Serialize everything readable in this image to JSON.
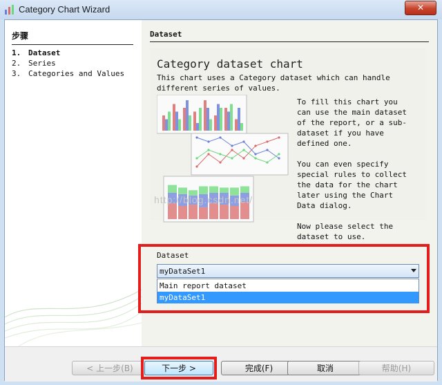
{
  "window": {
    "title": "Category Chart Wizard",
    "close_glyph": "✕"
  },
  "steps": {
    "heading": "步骤",
    "items": [
      {
        "num": "1.",
        "label": "Dataset",
        "active": true
      },
      {
        "num": "2.",
        "label": "Series",
        "active": false
      },
      {
        "num": "3.",
        "label": "Categories and Values",
        "active": false
      }
    ]
  },
  "main": {
    "section_title": "Dataset",
    "chart_title": "Category dataset chart",
    "description": "This chart uses a Category dataset which can handle different series of values.",
    "side_paragraphs": [
      "To fill this chart you can use the main dataset of the report, or a sub-dataset if you have defined one.",
      "You can even specify special rules to collect the data for the chart later using the Chart Data dialog.",
      "Now please select the dataset to use."
    ],
    "watermark": "http://blog.csdn.net/",
    "dataset": {
      "label": "Dataset",
      "selected": "myDataSet1",
      "options": [
        "Main report dataset",
        "myDataSet1"
      ],
      "highlighted_index": 1
    }
  },
  "preview": {
    "bar_values": [
      [
        4,
        7,
        6,
        5,
        8,
        4,
        6,
        3
      ],
      [
        3,
        5,
        8,
        2,
        6,
        7,
        5,
        6
      ],
      [
        5,
        3,
        4,
        6,
        3,
        6,
        7,
        2
      ]
    ],
    "line_points": [
      [
        1,
        4,
        2,
        5,
        3,
        6,
        7,
        8
      ],
      [
        8,
        7,
        8,
        6,
        7,
        4,
        5,
        3
      ],
      [
        3,
        5,
        4,
        3,
        5,
        3,
        2,
        4
      ]
    ],
    "stack_values": [
      [
        60,
        50,
        55,
        45,
        60,
        55,
        50,
        65
      ],
      [
        40,
        45,
        35,
        50,
        40,
        45,
        40,
        35
      ],
      [
        30,
        25,
        20,
        30,
        25,
        20,
        30,
        25
      ]
    ]
  },
  "colors": {
    "series": [
      "#d96a6a",
      "#6a7fd9",
      "#6ad97a"
    ],
    "highlight": "#e31c1c",
    "selection": "#3399ff"
  },
  "buttons": {
    "back": "< 上一步(B)",
    "next": "下一步 >",
    "finish": "完成(F)",
    "cancel": "取消",
    "help": "帮助(H)"
  }
}
